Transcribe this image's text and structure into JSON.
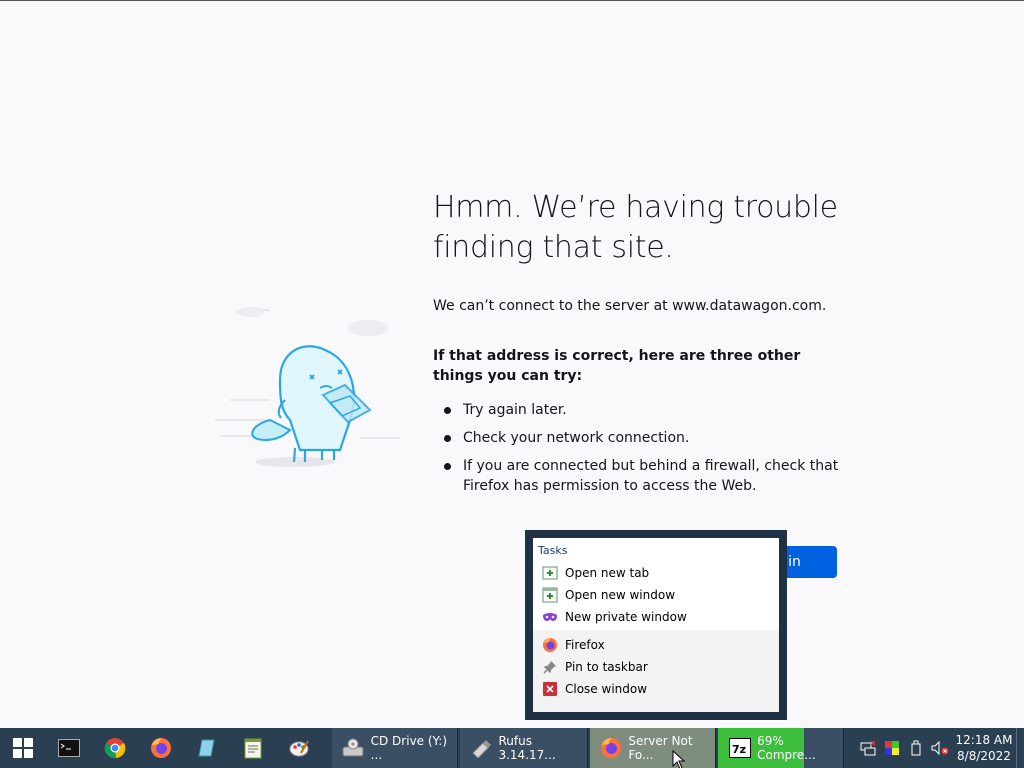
{
  "error_page": {
    "title": "Hmm. We’re having trouble finding that site.",
    "description": "We can’t connect to the server at www.datawagon.com.",
    "tips_heading": "If that address is correct, here are three other things you can try:",
    "tips": [
      "Try again later.",
      "Check your network connection.",
      "If you are connected but behind a firewall, check that Firefox has permission to access the Web."
    ],
    "button_label": "Try Again",
    "button_visible_text": "gain"
  },
  "jumplist": {
    "header": "Tasks",
    "tasks": [
      {
        "label": "Open new tab",
        "icon": "new-tab-icon"
      },
      {
        "label": "Open new window",
        "icon": "new-window-icon"
      },
      {
        "label": "New private window",
        "icon": "private-mask-icon"
      }
    ],
    "app_items": [
      {
        "label": "Firefox",
        "icon": "firefox-icon"
      },
      {
        "label": "Pin to taskbar",
        "icon": "pin-icon"
      },
      {
        "label": "Close window",
        "icon": "close-window-icon"
      }
    ]
  },
  "taskbar": {
    "pinned": [
      "start-icon",
      "terminal-icon",
      "chrome-icon",
      "firefox-icon",
      "app-icon",
      "notepad-icon",
      "paint-icon"
    ],
    "buttons": [
      {
        "label": "CD Drive (Y:) ...",
        "icon": "cd-drive-icon"
      },
      {
        "label": "Rufus 3.14.17...",
        "icon": "usb-icon"
      },
      {
        "label": "Server Not Fo...",
        "icon": "firefox-icon"
      },
      {
        "label": "69% Compre...",
        "icon": "7zip-icon"
      }
    ],
    "progress_percent": 69,
    "clock": {
      "time": "12:18 AM",
      "date": "8/8/2022"
    }
  },
  "colors": {
    "accent": "#0061e0",
    "taskbar": "#2b3f52",
    "page_bg": "#f9f9fb"
  }
}
